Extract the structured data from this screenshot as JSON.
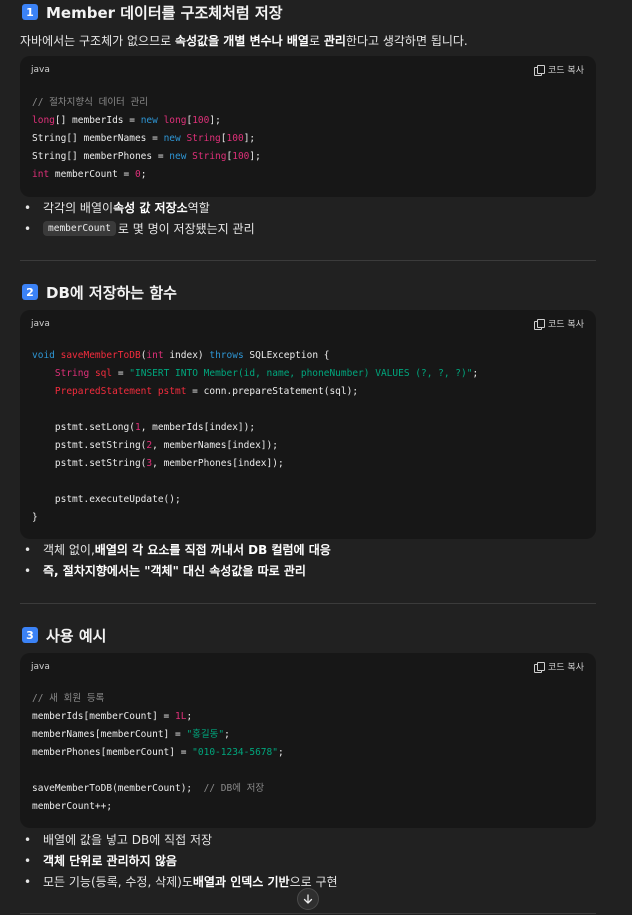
{
  "section1": {
    "badge": "1",
    "title": "Member 데이터를 구조체처럼 저장",
    "intro_a": "자바에서는 구조체가 없으므로 ",
    "intro_b": "속성값을 개별 변수나 배열",
    "intro_c": "로 ",
    "intro_d": "관리",
    "intro_e": "한다고 생각하면 됩니다.",
    "code": {
      "lang": "java",
      "copy_label": "코드 복사",
      "lines": [
        [
          [
            "c-cm",
            "// 절차지향식 데이터 관리"
          ]
        ],
        [
          [
            "c-ty",
            "long"
          ],
          [
            "c-pl",
            "[] memberIds = "
          ],
          [
            "c-kw",
            "new "
          ],
          [
            "c-ty",
            "long"
          ],
          [
            "c-pl",
            "["
          ],
          [
            "c-nu",
            "100"
          ],
          [
            "c-pl",
            "];"
          ]
        ],
        [
          [
            "c-pl",
            "String[] memberNames = "
          ],
          [
            "c-kw",
            "new "
          ],
          [
            "c-ty",
            "String"
          ],
          [
            "c-pl",
            "["
          ],
          [
            "c-nu",
            "100"
          ],
          [
            "c-pl",
            "];"
          ]
        ],
        [
          [
            "c-pl",
            "String[] memberPhones = "
          ],
          [
            "c-kw",
            "new "
          ],
          [
            "c-ty",
            "String"
          ],
          [
            "c-pl",
            "["
          ],
          [
            "c-nu",
            "100"
          ],
          [
            "c-pl",
            "];"
          ]
        ],
        [
          [
            "c-ty",
            "int "
          ],
          [
            "c-pl",
            "memberCount = "
          ],
          [
            "c-nu",
            "0"
          ],
          [
            "c-pl",
            ";"
          ]
        ]
      ]
    },
    "bullet1_a": "각각의 배열이 ",
    "bullet1_b": "속성 값 저장소",
    "bullet1_c": " 역할",
    "bullet2_code": "memberCount",
    "bullet2_text": "로 몇 명이 저장됐는지 관리"
  },
  "section2": {
    "badge": "2",
    "title": "DB에 저장하는 함수",
    "code": {
      "lang": "java",
      "copy_label": "코드 복사",
      "lines": [
        [
          [
            "c-kw",
            "void "
          ],
          [
            "c-fn",
            "saveMemberToDB"
          ],
          [
            "c-pl",
            "("
          ],
          [
            "c-ty",
            "int "
          ],
          [
            "c-pl",
            "index) "
          ],
          [
            "c-kw",
            "throws "
          ],
          [
            "c-pl",
            "SQLException {"
          ]
        ],
        [
          [
            "c-pl",
            "    "
          ],
          [
            "c-ty",
            "String "
          ],
          [
            "c-fn",
            "sql "
          ],
          [
            "c-pl",
            "= "
          ],
          [
            "c-st",
            "\"INSERT INTO Member(id, name, phoneNumber) VALUES (?, ?, ?)\""
          ],
          [
            "c-pl",
            ";"
          ]
        ],
        [
          [
            "c-pl",
            "    "
          ],
          [
            "c-fn",
            "PreparedStatement pstmt "
          ],
          [
            "c-pl",
            "= conn.prepareStatement(sql);"
          ]
        ],
        [
          [
            "c-pl",
            ""
          ]
        ],
        [
          [
            "c-pl",
            "    pstmt.setLong("
          ],
          [
            "c-nu",
            "1"
          ],
          [
            "c-pl",
            ", memberIds[index]);"
          ]
        ],
        [
          [
            "c-pl",
            "    pstmt.setString("
          ],
          [
            "c-nu",
            "2"
          ],
          [
            "c-pl",
            ", memberNames[index]);"
          ]
        ],
        [
          [
            "c-pl",
            "    pstmt.setString("
          ],
          [
            "c-nu",
            "3"
          ],
          [
            "c-pl",
            ", memberPhones[index]);"
          ]
        ],
        [
          [
            "c-pl",
            ""
          ]
        ],
        [
          [
            "c-pl",
            "    pstmt.executeUpdate();"
          ]
        ],
        [
          [
            "c-pl",
            "}"
          ]
        ]
      ]
    },
    "bullet1_a": "객체 없이, ",
    "bullet1_b": "배열의 각 요소를 직접 꺼내서 DB 컬럼에 대응",
    "bullet2_b": "즉, 절차지향에서는 \"객체\" 대신 속성값을 따로 관리"
  },
  "section3": {
    "badge": "3",
    "title": "사용 예시",
    "code": {
      "lang": "java",
      "copy_label": "코드 복사",
      "lines": [
        [
          [
            "c-cm",
            "// 새 회원 등록"
          ]
        ],
        [
          [
            "c-pl",
            "memberIds[memberCount] = "
          ],
          [
            "c-nu",
            "1L"
          ],
          [
            "c-pl",
            ";"
          ]
        ],
        [
          [
            "c-pl",
            "memberNames[memberCount] = "
          ],
          [
            "c-st",
            "\"홍길동\""
          ],
          [
            "c-pl",
            ";"
          ]
        ],
        [
          [
            "c-pl",
            "memberPhones[memberCount] = "
          ],
          [
            "c-st",
            "\"010-1234-5678\""
          ],
          [
            "c-pl",
            ";"
          ]
        ],
        [
          [
            "c-pl",
            ""
          ]
        ],
        [
          [
            "c-pl",
            "saveMemberToDB(memberCount);  "
          ],
          [
            "c-cm",
            "// DB에 저장"
          ]
        ],
        [
          [
            "c-pl",
            "memberCount++;"
          ]
        ]
      ]
    },
    "bullet1": "배열에 값을 넣고 DB에 직접 저장",
    "bullet2": "객체 단위로 관리하지 않음",
    "bullet3_a": "모든 기능(등록, 수정, 삭제)도 ",
    "bullet3_b": "배열과 인덱스 기반",
    "bullet3_c": "으로 구현"
  },
  "ui": {
    "scroll_down_icon": "arrow-down-icon",
    "bullet_glyph": "•"
  }
}
